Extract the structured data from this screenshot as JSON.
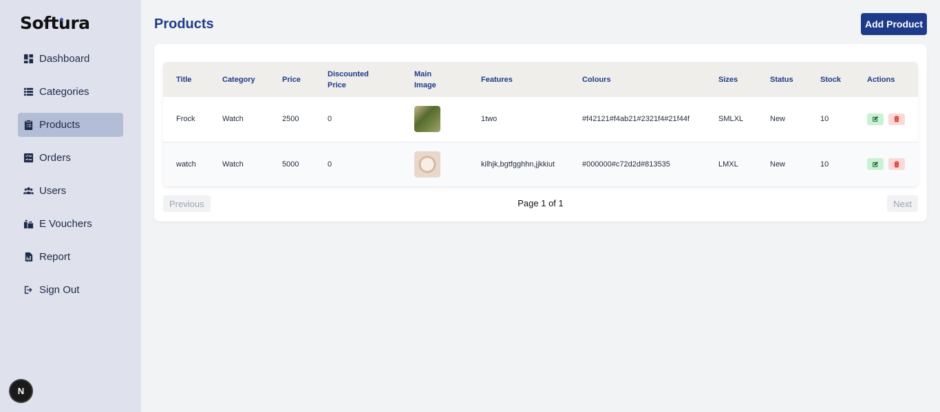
{
  "brand": {
    "name_part1": "Soft",
    "name_part2": "ura",
    "accent": "#2f4fb5"
  },
  "sidebar": {
    "items": [
      {
        "label": "Dashboard",
        "icon": "dashboard-icon",
        "active": false
      },
      {
        "label": "Categories",
        "icon": "list-icon",
        "active": false
      },
      {
        "label": "Products",
        "icon": "clipboard-icon",
        "active": true
      },
      {
        "label": "Orders",
        "icon": "checklist-icon",
        "active": false
      },
      {
        "label": "Users",
        "icon": "users-icon",
        "active": false
      },
      {
        "label": "E Vouchers",
        "icon": "voucher-icon",
        "active": false
      },
      {
        "label": "Report",
        "icon": "report-icon",
        "active": false
      },
      {
        "label": "Sign Out",
        "icon": "sign-out-icon",
        "active": false
      }
    ]
  },
  "header": {
    "title": "Products",
    "add_button": "Add Product"
  },
  "table": {
    "columns": [
      "Title",
      "Category",
      "Price",
      "Discounted Price",
      "Main Image",
      "Features",
      "Colours",
      "Sizes",
      "Status",
      "Stock",
      "Actions"
    ],
    "rows": [
      {
        "title": "Frock",
        "category": "Watch",
        "price": "2500",
        "discounted": "0",
        "image": "frock-image",
        "features": "1two",
        "colours": "#f42121#f4ab21#2321f4#21f44f",
        "sizes": "SMLXL",
        "status": "New",
        "stock": "10"
      },
      {
        "title": "watch",
        "category": "Watch",
        "price": "5000",
        "discounted": "0",
        "image": "watch-image",
        "features": "kilhjk,bgtfgghhn,jjkkiut",
        "colours": "#000000#c72d2d#813535",
        "sizes": "LMXL",
        "status": "New",
        "stock": "10"
      }
    ]
  },
  "pagination": {
    "previous": "Previous",
    "info": "Page 1 of 1",
    "next": "Next"
  },
  "badge": {
    "letter": "N"
  },
  "colors": {
    "primary": "#1e3a8a",
    "sidebar_bg": "#dfe2ec",
    "active_bg": "#b4bdd6"
  }
}
